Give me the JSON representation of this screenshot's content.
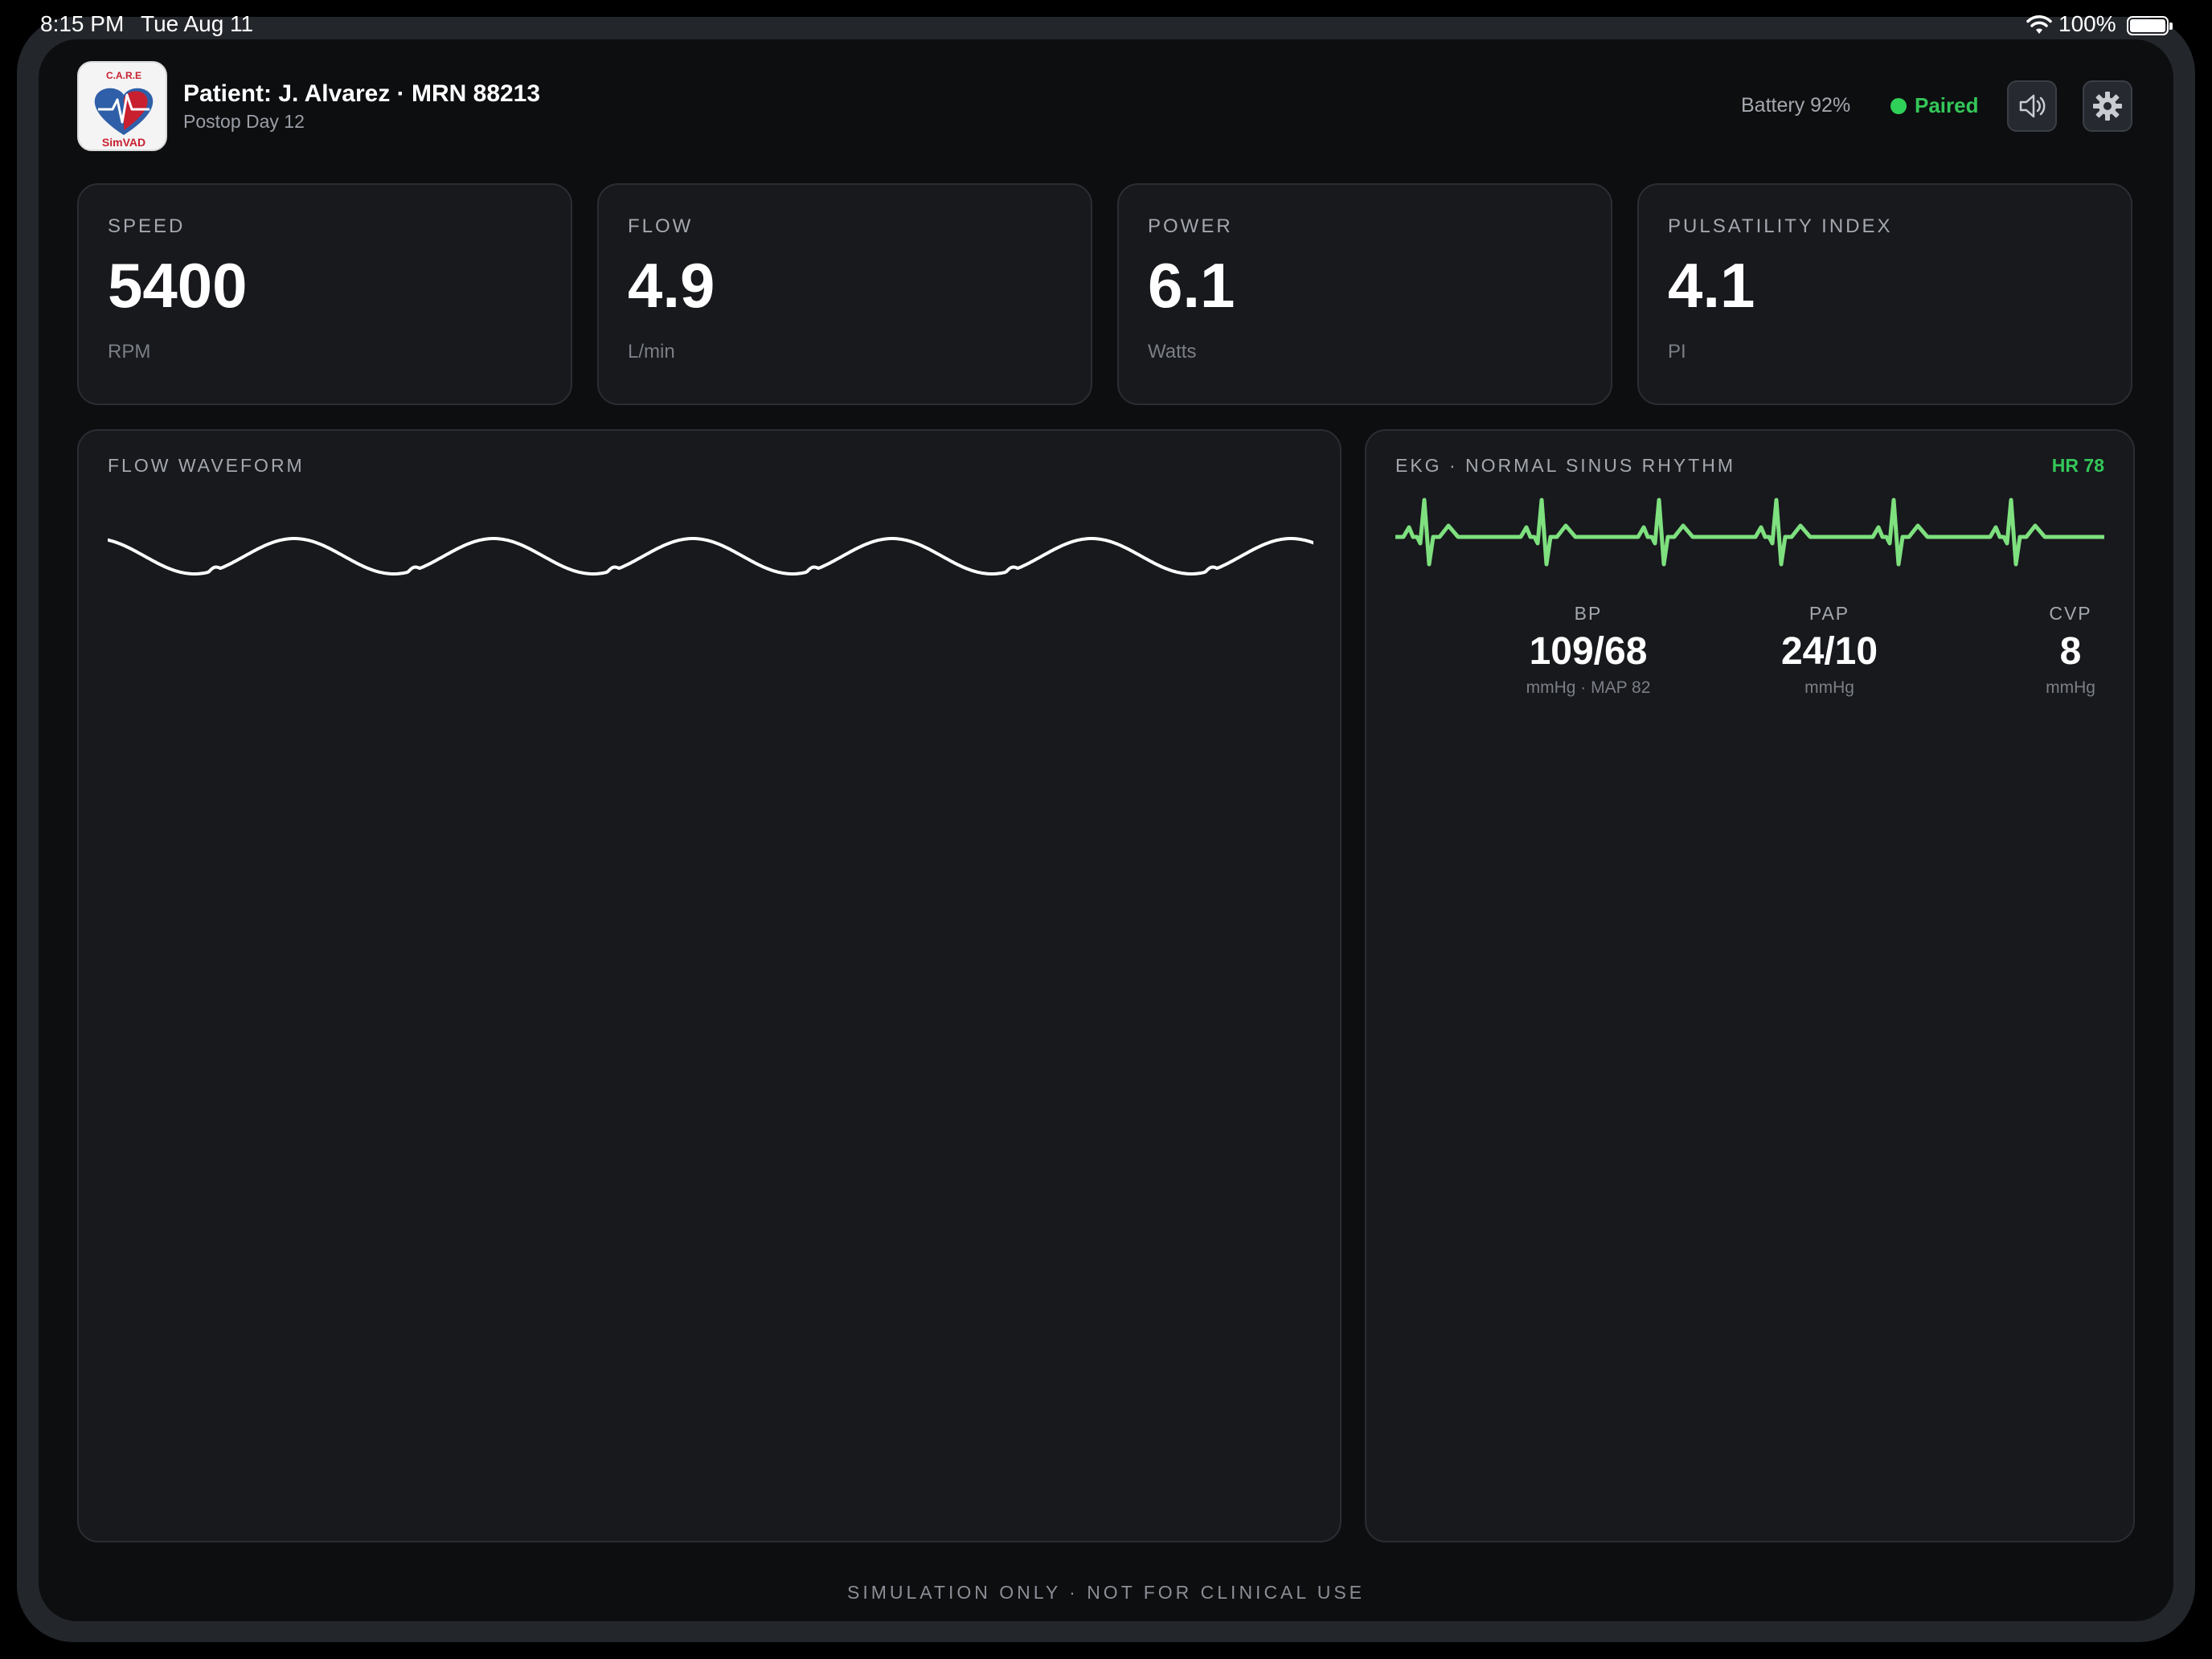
{
  "status_bar": {
    "time": "8:15 PM",
    "date": "Tue Aug 11",
    "battery_percent": "100%",
    "icons": [
      "wifi-icon",
      "battery-icon"
    ]
  },
  "header": {
    "logo": {
      "top_text": "C.A.R.E",
      "bottom_text": "SimVAD"
    },
    "patient": "Patient: J. Alvarez · MRN 88213",
    "postop": "Postop Day 12",
    "battery": "Battery 92%",
    "paired": "Paired",
    "paired_color": "#30d158",
    "buttons": [
      "speaker-icon",
      "gear-icon"
    ]
  },
  "metrics": [
    {
      "label": "SPEED",
      "value": "5400",
      "unit": "RPM"
    },
    {
      "label": "FLOW",
      "value": "4.9",
      "unit": "L/min"
    },
    {
      "label": "POWER",
      "value": "6.1",
      "unit": "Watts"
    },
    {
      "label": "PULSATILITY INDEX",
      "value": "4.1",
      "unit": "PI"
    }
  ],
  "flow_panel": {
    "title": "FLOW WAVEFORM",
    "line_color": "#ffffff"
  },
  "ekg_panel": {
    "title": "EKG · NORMAL SINUS RHYTHM",
    "hr": "HR 78",
    "line_color": "#7ee07e",
    "vitals": [
      {
        "label": "BP",
        "value": "109/68",
        "unit": "mmHg · MAP 82"
      },
      {
        "label": "PAP",
        "value": "24/10",
        "unit": "mmHg"
      },
      {
        "label": "CVP",
        "value": "8",
        "unit": "mmHg"
      }
    ]
  },
  "footer": "SIMULATION ONLY · NOT FOR CLINICAL USE",
  "colors": {
    "background": "#0d0e10",
    "card": "#17191d",
    "accent_green": "#34c759"
  }
}
